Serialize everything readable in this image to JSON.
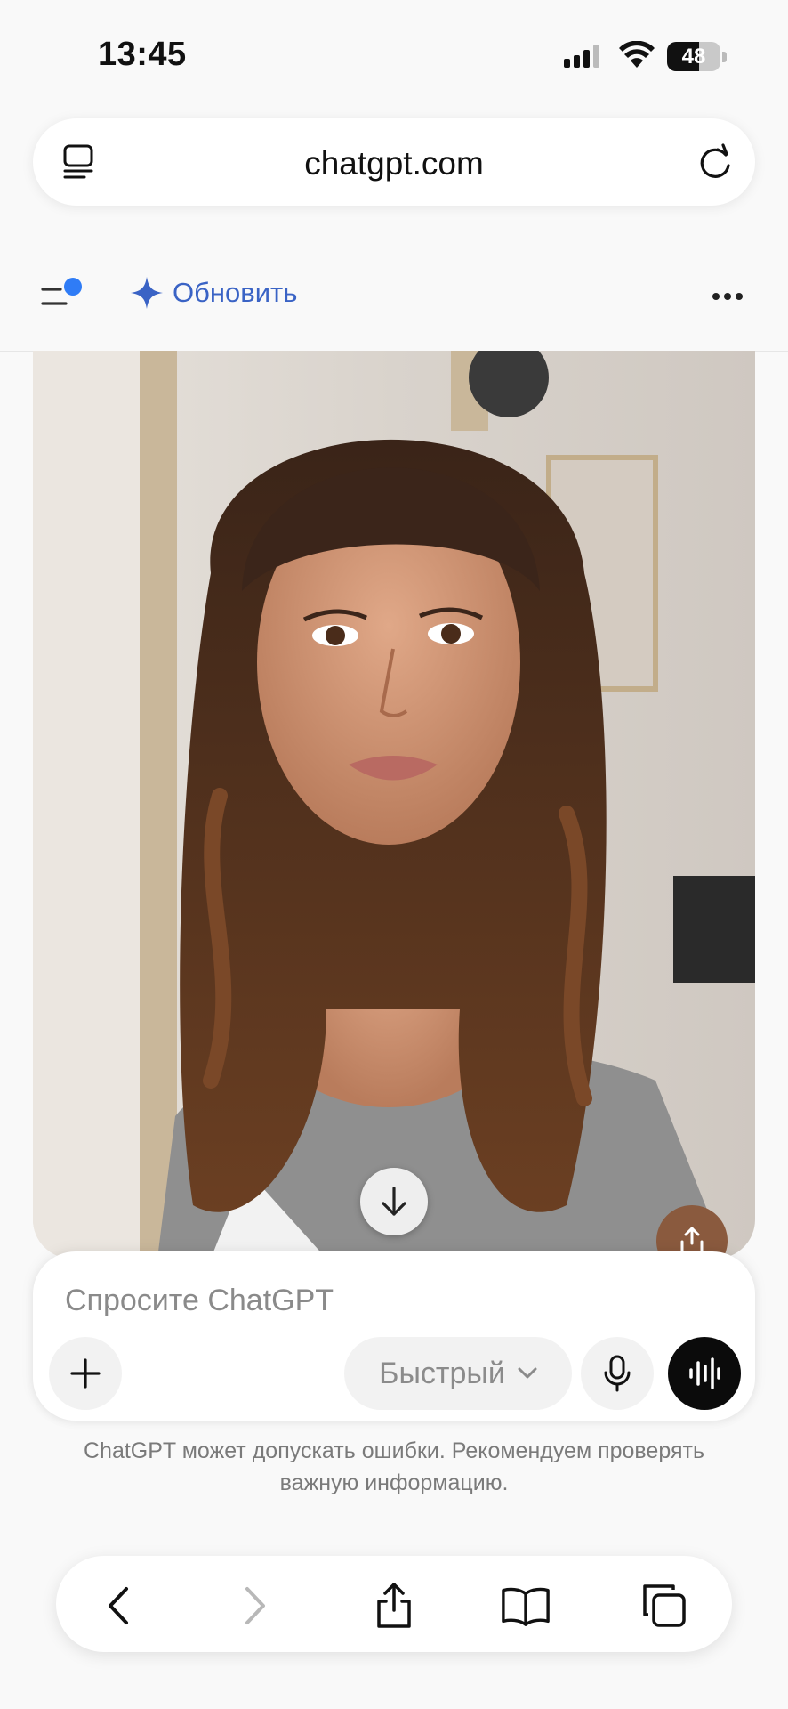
{
  "status_bar": {
    "time": "13:45",
    "battery": "48"
  },
  "browser": {
    "url": "chatgpt.com"
  },
  "header": {
    "upgrade_label": "Обновить"
  },
  "composer": {
    "placeholder": "Спросите ChatGPT",
    "model_label": "Быстрый"
  },
  "disclaimer": "ChatGPT может допускать ошибки. Рекомендуем проверять важную информацию.",
  "colors": {
    "accent": "#3a63c5",
    "notification_dot": "#2f7cf6",
    "voice_button": "#0b0b0b"
  },
  "icons": [
    "tabs-overview-icon",
    "reload-icon",
    "menu-icon",
    "sparkle-icon",
    "more-icon",
    "arrow-down-icon",
    "share-icon",
    "plus-icon",
    "chevron-down-icon",
    "mic-icon",
    "voice-wave-icon",
    "back-icon",
    "forward-icon",
    "bookmarks-icon",
    "tabs-icon"
  ]
}
